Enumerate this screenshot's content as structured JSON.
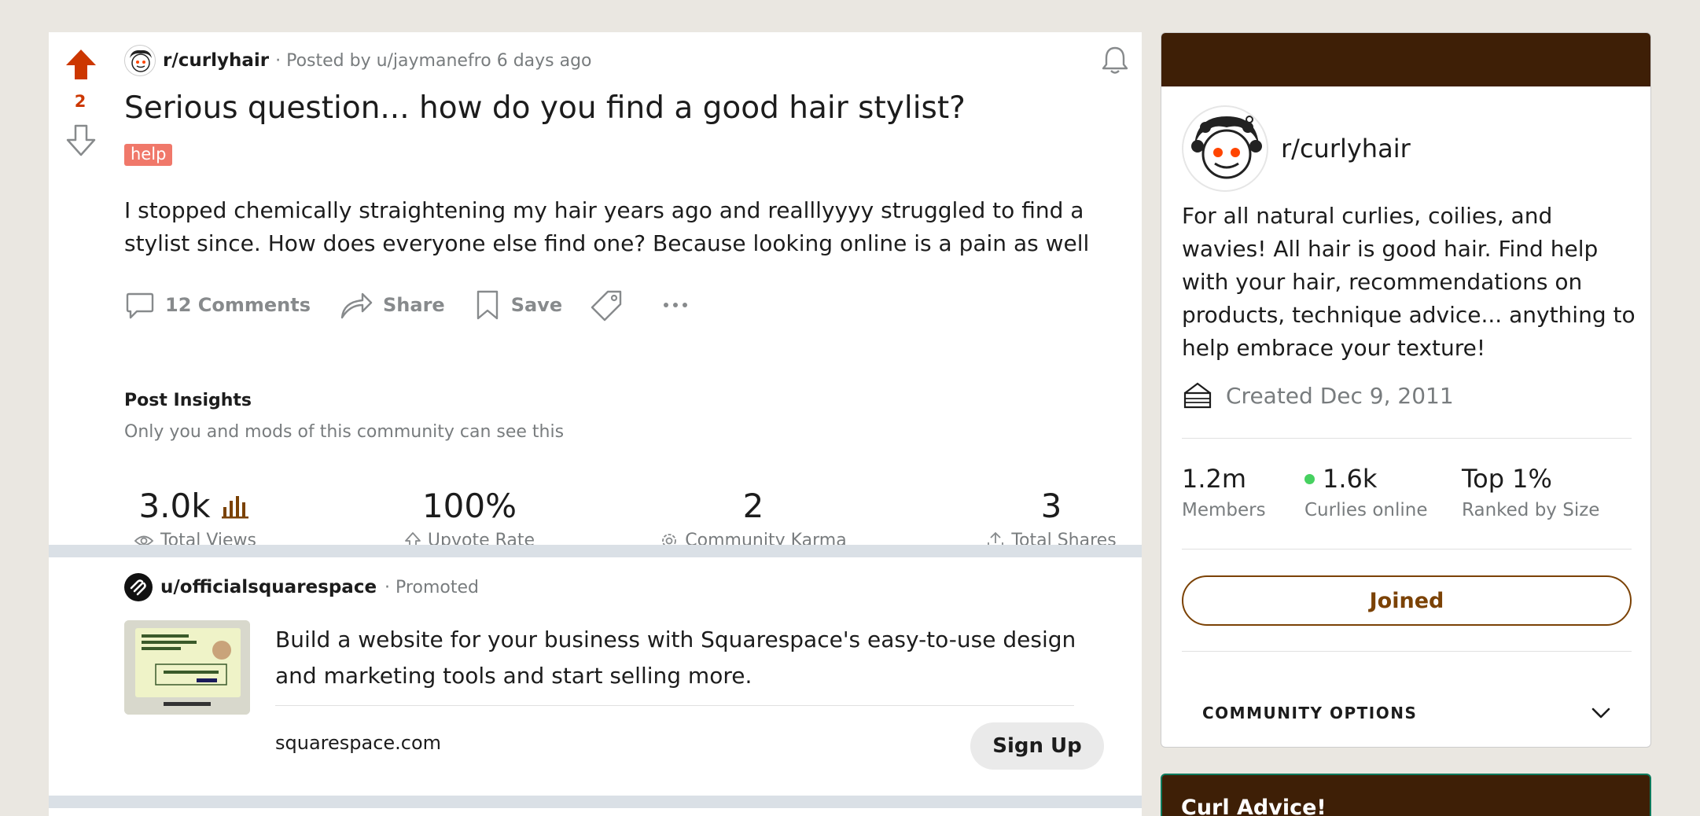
{
  "post": {
    "vote_count": "2",
    "subreddit": "r/curlyhair",
    "meta": "· Posted by u/jaymanefro 6 days ago",
    "title": "Serious question... how do you find a good hair stylist?",
    "flair": "help",
    "body": "I stopped chemically straightening my hair years ago and realllyyyy struggled to find a stylist since. How does everyone else find one? Because looking online is a pain as well",
    "actions": {
      "comments": "12 Comments",
      "share": "Share",
      "save": "Save"
    },
    "insights": {
      "title": "Post Insights",
      "subtitle": "Only you and mods of this community can see this",
      "stats": [
        {
          "value": "3.0k",
          "label": "Total Views"
        },
        {
          "value": "100%",
          "label": "Upvote Rate"
        },
        {
          "value": "2",
          "label": "Community Karma"
        },
        {
          "value": "3",
          "label": "Total Shares"
        }
      ]
    }
  },
  "promo": {
    "user": "u/officialsquarespace",
    "tag": "Promoted",
    "text": "Build a website for your business with Squarespace's easy-to-use design and marketing tools and start selling more.",
    "domain": "squarespace.com",
    "cta": "Sign Up"
  },
  "sidebar": {
    "name": "r/curlyhair",
    "description": "For all natural curlies, coilies, and wavies! All hair is good hair. Find help with your hair, recommendations on products, technique advice... anything to help embrace your texture!",
    "created": "Created Dec 9, 2011",
    "stats": [
      {
        "value": "1.2m",
        "label": "Members"
      },
      {
        "value": "1.6k",
        "label": "Curlies online"
      },
      {
        "value": "Top 1%",
        "label": "Ranked by Size"
      }
    ],
    "joined_label": "Joined",
    "community_options": "COMMUNITY OPTIONS"
  },
  "sidebar2": {
    "title": "Curl Advice!"
  },
  "colors": {
    "upvote": "#cc3700",
    "banner": "#3e1f06",
    "accent": "#7b4205",
    "flair": "#f0786a",
    "online": "#46d160"
  }
}
